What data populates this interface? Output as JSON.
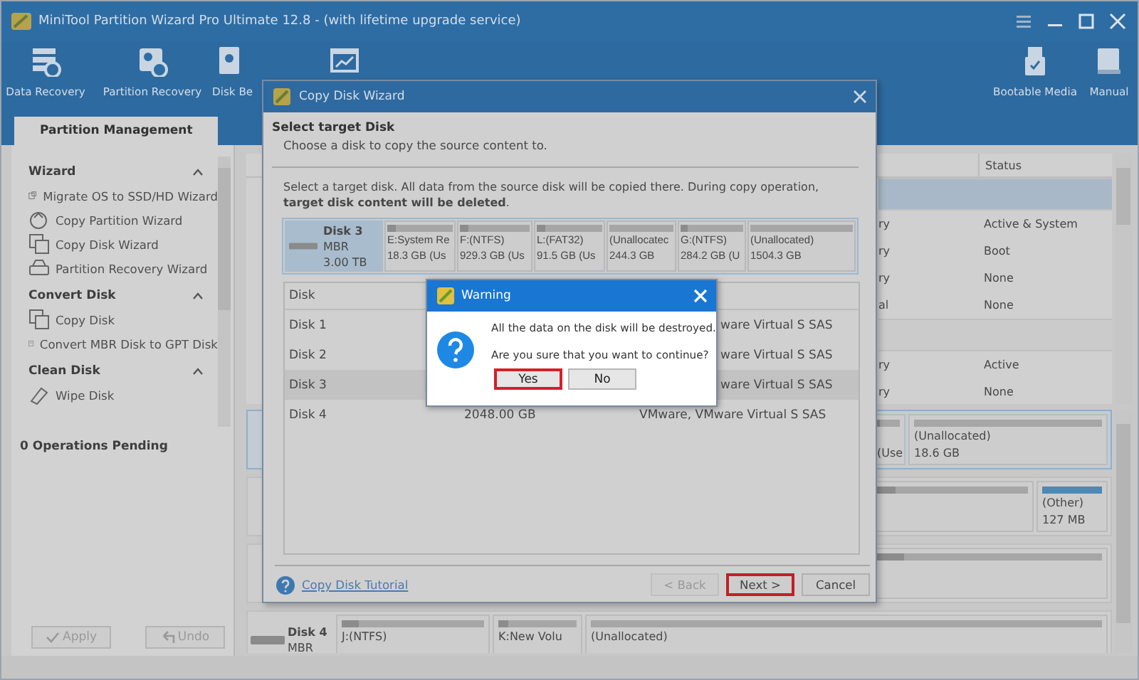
{
  "app": {
    "title": "MiniTool Partition Wizard Pro Ultimate 12.8 - (with lifetime upgrade service)",
    "toolbar": [
      {
        "kind": "data",
        "label": "Data Recovery"
      },
      {
        "kind": "partition",
        "label": "Partition Recovery"
      },
      {
        "kind": "benchmark",
        "label": "Disk Be"
      },
      {
        "kind": "analyzer"
      },
      {
        "kind": "spacer"
      },
      {
        "kind": "usb",
        "label": "Bootable Media"
      },
      {
        "kind": "book",
        "label": "Manual"
      }
    ],
    "tabs": [
      {
        "label": "Partition Management",
        "selected": true
      }
    ],
    "sidebar": {
      "sections": [
        {
          "title": "Wizard",
          "expanded": true,
          "items": [
            {
              "kind": "migrate",
              "label": "Migrate OS to SSD/HD Wizard"
            },
            {
              "kind": "copypart",
              "label": "Copy Partition Wizard"
            },
            {
              "kind": "copydisk",
              "label": "Copy Disk Wizard"
            },
            {
              "kind": "recover",
              "label": "Partition Recovery Wizard"
            }
          ]
        },
        {
          "title": "Convert Disk",
          "expanded": true,
          "items": [
            {
              "kind": "copydisk",
              "label": "Copy Disk"
            },
            {
              "kind": "convert",
              "label": "Convert MBR Disk to GPT Disk"
            }
          ]
        },
        {
          "title": "Clean Disk",
          "expanded": true,
          "items": [
            {
              "kind": "wipe",
              "label": "Wipe Disk"
            }
          ]
        }
      ],
      "pending": "0 Operations Pending",
      "buttons": [
        {
          "kind": "apply",
          "label": "Apply",
          "disabled": true
        },
        {
          "kind": "undo",
          "label": "Undo",
          "disabled": true
        }
      ]
    },
    "partition_table": {
      "columns": [
        "Status"
      ],
      "rows": [
        {
          "kind": "disk",
          "selected": true
        },
        {
          "kind": "part",
          "column_1": "ry",
          "status": "Active & System",
          "selected": false
        },
        {
          "kind": "part",
          "column_1": "ry",
          "status": "Boot",
          "selected": false
        },
        {
          "kind": "part",
          "column_1": "ry",
          "status": "None",
          "selected": false
        },
        {
          "kind": "part",
          "column_1": "al",
          "status": "None",
          "selected": false
        },
        {
          "kind": "disk",
          "selected": false
        },
        {
          "kind": "part",
          "column_1": "ry",
          "status": "Active",
          "selected": false
        },
        {
          "kind": "part",
          "column_1": "ry",
          "status": "None",
          "selected": false
        }
      ]
    },
    "disk_map": [
      {
        "selected": true,
        "partitions": [
          {
            "kind": "covered"
          },
          {
            "kind": "used",
            "line_2": "(Use"
          },
          {
            "kind": "free",
            "line_1": "(Unallocated)",
            "line_2": "18.6 GB"
          }
        ]
      },
      {
        "selected": false,
        "partitions": [
          {
            "kind": "covered"
          },
          {
            "kind": "used"
          },
          {
            "kind": "other",
            "line_1": "(Other)",
            "line_2": "127 MB"
          }
        ]
      },
      {
        "selected": false,
        "partitions": [
          {
            "kind": "covered"
          },
          {
            "kind": "used"
          }
        ]
      },
      {
        "selected": false,
        "disk": {
          "name": "Disk 4",
          "type": "MBR"
        },
        "partitions": [
          {
            "kind": "used",
            "line_1": "J:(NTFS)"
          },
          {
            "kind": "used",
            "line_1": "K:New Volu"
          },
          {
            "kind": "free",
            "line_1": "(Unallocated)"
          }
        ]
      }
    ]
  },
  "wizard": {
    "title": "Copy Disk Wizard",
    "heading": "Select target Disk",
    "subtitle": "Choose a disk to copy the source content to.",
    "note": "Select a target disk. All data from the source disk will be copied there. During copy operation, **target disk content will be deleted**.",
    "disk": {
      "name": "Disk 3",
      "type": "MBR",
      "size": "3.00 TB",
      "selected": true
    },
    "partitions": [
      {
        "kind": "used",
        "label": "E:System Re",
        "size": "18.3 GB (Us"
      },
      {
        "kind": "used",
        "label": "F:(NTFS)",
        "size": "929.3 GB (Us"
      },
      {
        "kind": "used",
        "label": "L:(FAT32)",
        "size": "91.5 GB (Us"
      },
      {
        "kind": "free",
        "label": "(Unallocatec",
        "size": "244.3 GB"
      },
      {
        "kind": "used",
        "label": "G:(NTFS)",
        "size": "284.2 GB (U"
      },
      {
        "kind": "free",
        "label": "(Unallocated)",
        "size": "1504.3 GB"
      }
    ],
    "table": {
      "columns": [
        "Disk"
      ],
      "rows": [
        {
          "disk": "Disk 1",
          "model": "ware Virtual S SAS",
          "covered": true,
          "selected": false
        },
        {
          "disk": "Disk 2",
          "model": "ware Virtual S SAS",
          "covered": true,
          "selected": false
        },
        {
          "disk": "Disk 3",
          "model": "ware Virtual S SAS",
          "covered": true,
          "selected": true
        },
        {
          "disk": "Disk 4",
          "capacity": "2048.00 GB",
          "model": "VMware, VMware Virtual S SAS",
          "covered": false,
          "selected": false
        }
      ]
    },
    "tutorial": "Copy Disk Tutorial",
    "buttons": [
      {
        "label": "< Back",
        "disabled": true,
        "highlighted": false
      },
      {
        "label": "Next >",
        "disabled": false,
        "highlighted": true
      },
      {
        "label": "Cancel",
        "disabled": false,
        "highlighted": false
      }
    ]
  },
  "warning": {
    "title": "Warning",
    "message": "All the data on the disk will be destroyed.",
    "question": "Are you sure that you want to continue?",
    "buttons": [
      {
        "label": "Yes",
        "highlighted": true
      },
      {
        "label": "No",
        "highlighted": false
      }
    ]
  }
}
